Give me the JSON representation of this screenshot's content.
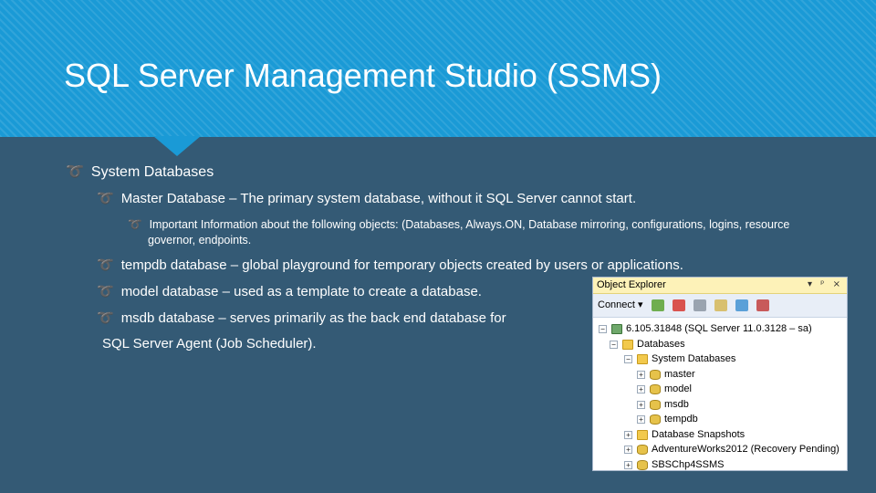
{
  "slide": {
    "title": "SQL Server Management Studio (SSMS)",
    "bullets": {
      "system_databases": "System Databases",
      "master": "Master Database – The primary system database, without it SQL Server cannot start.",
      "master_info": "Important Information about the following objects:  (Databases, Always.ON, Database mirroring, configurations, logins, resource governor, endpoints.",
      "tempdb": "tempdb database – global playground for temporary objects created by users or applications.",
      "model": "model database – used as a template to create a database.",
      "msdb": "msdb database – serves primarily as the back end database for",
      "msdb_cont": "SQL Server Agent (Job Scheduler)."
    },
    "bullet_icon": "curly-arrow-icon",
    "colors": {
      "background": "#345a75",
      "header": "#1a9ad6",
      "text": "#ffffff"
    }
  },
  "object_explorer": {
    "title": "Object Explorer",
    "title_buttons": "▾ ᵖ ×",
    "connect_label": "Connect ▾",
    "tree": {
      "server": "6.105.31848 (SQL Server 11.0.3128 – sa)",
      "databases": "Databases",
      "system_databases": "System Databases",
      "master": "master",
      "model": "model",
      "msdb": "msdb",
      "tempdb": "tempdb",
      "snapshots": "Database Snapshots",
      "adventureworks": "AdventureWorks2012 (Recovery Pending)",
      "sbschp": "SBSChp4SSMS"
    }
  }
}
